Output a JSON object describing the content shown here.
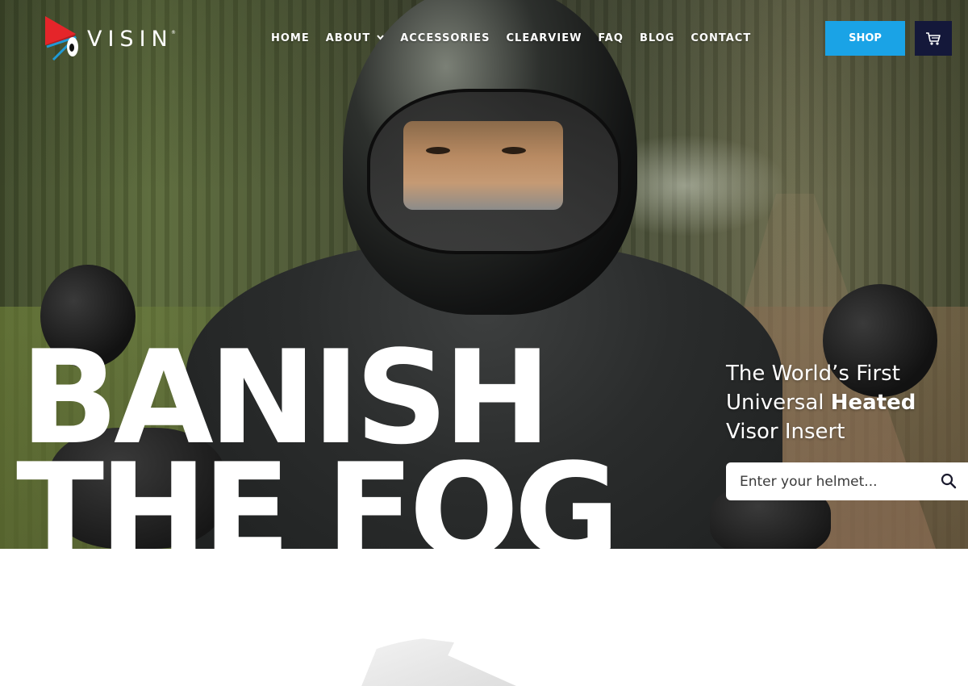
{
  "brand": {
    "name": "VISIN",
    "registered": "®"
  },
  "nav": {
    "items": [
      {
        "label": "HOME",
        "has_dropdown": false
      },
      {
        "label": "ABOUT",
        "has_dropdown": true
      },
      {
        "label": "ACCESSORIES",
        "has_dropdown": false
      },
      {
        "label": "CLEARVIEW",
        "has_dropdown": false
      },
      {
        "label": "FAQ",
        "has_dropdown": false
      },
      {
        "label": "BLOG",
        "has_dropdown": false
      },
      {
        "label": "CONTACT",
        "has_dropdown": false
      }
    ],
    "dropdown_icon": "chevron-down-icon"
  },
  "header": {
    "shop_label": "SHOP",
    "cart_icon": "cart-icon",
    "shop_color": "#1aa3e6",
    "cart_color": "#14183a"
  },
  "hero": {
    "headline_line1": "BANISH",
    "headline_line2": "THE FOG",
    "tagline_part1": "The World’s First Universal ",
    "tagline_bold": "Heated",
    "tagline_part2": " Visor Insert",
    "search": {
      "placeholder": "Enter your helmet...",
      "value": "",
      "icon": "search-icon"
    }
  },
  "colors": {
    "logo_red": "#e5252a",
    "logo_blue": "#1f9ad6",
    "text": "#ffffff"
  }
}
